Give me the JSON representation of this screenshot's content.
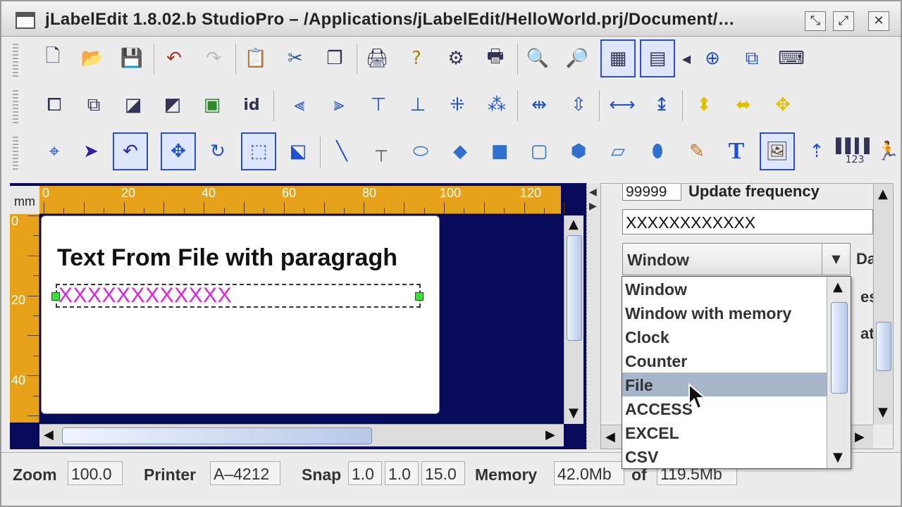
{
  "window": {
    "title": "jLabelEdit  1.8.02.b StudioPro  –  /Applications/jLabelEdit/HelloWorld.prj/Document/…",
    "controls": [
      "minimize-icon",
      "maximize-icon",
      "close-icon"
    ]
  },
  "toolbar": {
    "row1": [
      "new-document-icon",
      "open-folder-icon",
      "save-icon",
      "undo-icon",
      "redo-icon",
      "paste-icon",
      "cut-icon",
      "copy-icon",
      "print-setup-icon",
      "help-print-icon",
      "printer-tools-icon",
      "printer-icon",
      "zoom-in-icon",
      "zoom-out-icon",
      "page-layout-icon",
      "label-layout-icon",
      "expand-arrow-icon",
      "target-icon",
      "layers-icon",
      "keyboard-icon"
    ],
    "row2": [
      "bring-front-icon",
      "send-back-icon",
      "shadow-front-icon",
      "shadow-back-icon",
      "field-icon",
      "id-field-icon",
      "align-left-icon",
      "align-right-icon",
      "align-top-icon",
      "align-bottom-icon",
      "center-horizontal-icon",
      "center-vertical-icon",
      "distribute-h-icon",
      "distribute-v-icon",
      "space-h-icon",
      "space-v-icon",
      "resize-height-icon",
      "resize-width-icon",
      "resize-both-icon"
    ],
    "row3": [
      "select-target-icon",
      "pointer-icon",
      "undo-select-icon",
      "move-icon",
      "rotate-icon",
      "crop-icon",
      "select-edit-icon",
      "line-icon",
      "corner-line-icon",
      "ellipse-icon",
      "diamond-icon",
      "rectangle-icon",
      "rounded-rect-icon",
      "polygon-icon",
      "parallelogram-icon",
      "blob-icon",
      "pencil-icon",
      "text-tool-icon",
      "image-tool-icon",
      "upload-icon",
      "barcode-icon",
      "running-man-icon"
    ],
    "id_label": "id",
    "barcode_label": "123"
  },
  "editor": {
    "unit": "mm",
    "h_ruler_labels": [
      "0",
      "20",
      "40",
      "60",
      "80",
      "100",
      "120"
    ],
    "v_ruler_labels": [
      "0",
      "20",
      "40"
    ],
    "heading_text": "Text From File with paragragh",
    "field_text": "XXXXXXXXXXXX"
  },
  "properties": {
    "update_frequency_value": "99999",
    "update_frequency_label": "Update frequency",
    "text_value": "XXXXXXXXXXXX",
    "source_selected": "Window",
    "label_da": "Da",
    "label_es": "es",
    "label_at": "at"
  },
  "dropdown": {
    "items": [
      "Window",
      "Window with memory",
      "Clock",
      "Counter",
      "File",
      "ACCESS",
      "EXCEL",
      "CSV"
    ],
    "highlighted": "File"
  },
  "status": {
    "zoom_label": "Zoom",
    "zoom_value": "100.0",
    "printer_label": "Printer",
    "printer_value": "A–4212",
    "snap_label": "Snap",
    "snap_values": [
      "1.0",
      "1.0",
      "15.0"
    ],
    "memory_label": "Memory",
    "memory_value": "42.0Mb",
    "of_label": "of",
    "memory_total": "119.5Mb"
  },
  "colors": {
    "ruler": "#e6a21a",
    "workspace": "#0a0a5a",
    "field_text": "#e020e0",
    "selection": "#2a4fc8",
    "highlight": "#a8b6cc"
  }
}
